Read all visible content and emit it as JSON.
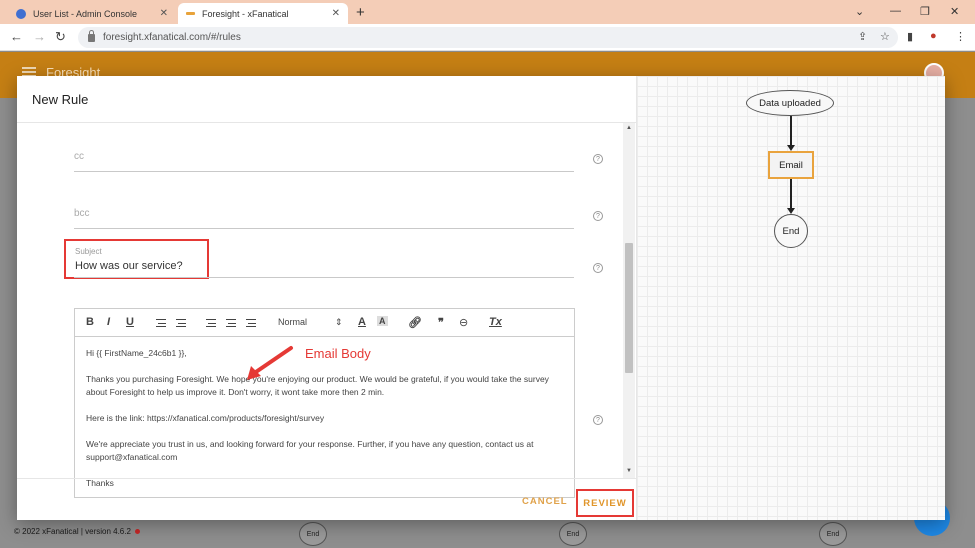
{
  "browser": {
    "tabs": [
      {
        "title": "User List - Admin Console",
        "active": false,
        "favicon_color": "#3f6fd1"
      },
      {
        "title": "Foresight - xFanatical",
        "active": true,
        "favicon_color": "#e8a33a"
      }
    ],
    "url": "foresight.xfanatical.com/#/rules"
  },
  "app": {
    "brand": "Foresight",
    "accent": "#c57f14",
    "footer": "© 2022 xFanatical | version 4.6.2",
    "background_nodes": [
      "End",
      "End",
      "End"
    ]
  },
  "dialog": {
    "title": "New Rule",
    "fields": {
      "cc_placeholder": "cc",
      "bcc_placeholder": "bcc",
      "subject_label": "Subject",
      "subject_value": "How was our service?"
    },
    "editor": {
      "toolbar": {
        "bold": "B",
        "italic": "I",
        "underline": "U",
        "format": "Normal",
        "font_color": "A",
        "background": "A",
        "blockquote": "❞",
        "clear": "Tx"
      },
      "paragraphs": [
        "Hi {{ FirstName_24c6b1 }},",
        "Thanks you purchasing Foresight. We hope you're enjoying our product. We would be grateful, if you would take the survey about Foresight to help us improve it. Don't worry, it wont take more then 2 min.",
        "Here is the link: https://xfanatical.com/products/foresight/survey",
        "We're appreciate you trust in us, and looking forward for your response. Further, if you have any question, contact us at support@xfanatical.com",
        "Thanks"
      ]
    },
    "annotation": "Email Body",
    "buttons": {
      "cancel": "CANCEL",
      "review": "REVIEW"
    },
    "highlight_color": "#e53935"
  },
  "flow": {
    "nodes": {
      "start": "Data uploaded",
      "email": "Email",
      "end": "End"
    }
  }
}
